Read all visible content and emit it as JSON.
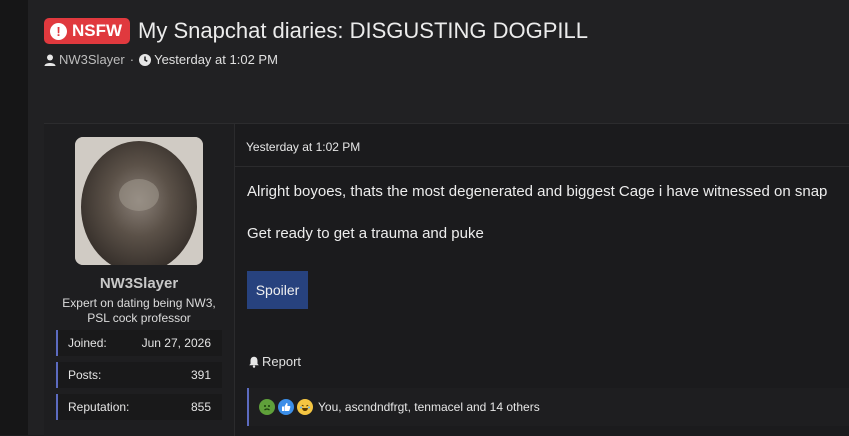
{
  "thread": {
    "badge": "NSFW",
    "title": "My Snapchat diaries: DISGUSTING DOGPILL",
    "author": "NW3Slayer",
    "separator": "·",
    "time": "Yesterday at 1:02 PM"
  },
  "user": {
    "name": "NW3Slayer",
    "title": "Expert on dating being NW3, PSL cock professor",
    "stats": [
      {
        "label": "Joined:",
        "value": "Jun 27, 2026"
      },
      {
        "label": "Posts:",
        "value": "391"
      },
      {
        "label": "Reputation:",
        "value": "855"
      }
    ]
  },
  "post": {
    "date": "Yesterday at 1:02 PM",
    "lines": [
      "Alright boyoes, thats the most degenerated and biggest Cage i have witnessed on snap",
      "Get ready to get a trauma and puke"
    ],
    "spoiler_label": "Spoiler",
    "report_label": "Report",
    "reactions_text": "You, ascndndfrgt, tenmacel and 14 others",
    "reaction_icons": [
      "nauseated-face-icon",
      "thumbs-up-icon",
      "laughing-icon"
    ]
  },
  "colors": {
    "accent": "#5c6bc0",
    "nsfw": "#e0393e",
    "spoiler": "#27427e"
  }
}
